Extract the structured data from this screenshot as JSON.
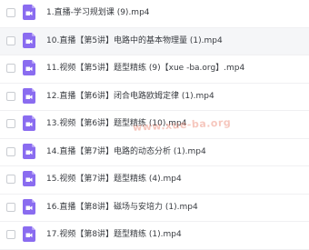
{
  "files": [
    {
      "name": "1.直播-学习规划课 (9).mp4"
    },
    {
      "name": "10.直播【第5讲】电路中的基本物理量 (1).mp4"
    },
    {
      "name": "11.视频【第5讲】题型精练 (9)【xue -ba.org】.mp4"
    },
    {
      "name": "12.直播【第6讲】闭合电路欧姆定律 (1).mp4"
    },
    {
      "name": "13.视频【第6讲】题型精练 (10).mp4"
    },
    {
      "name": "14.直播【第7讲】电路的动态分析 (1).mp4"
    },
    {
      "name": "15.视频【第7讲】题型精练 (4).mp4"
    },
    {
      "name": "16.直播【第8讲】磁场与安培力 (1).mp4"
    },
    {
      "name": "17.视频【第8讲】题型精练 (1).mp4"
    }
  ],
  "watermark": "www.xue-ba.org",
  "colors": {
    "icon": "#8a6cf0",
    "icon_fold": "#b8a5f7"
  },
  "icon_name": "video-file-icon"
}
